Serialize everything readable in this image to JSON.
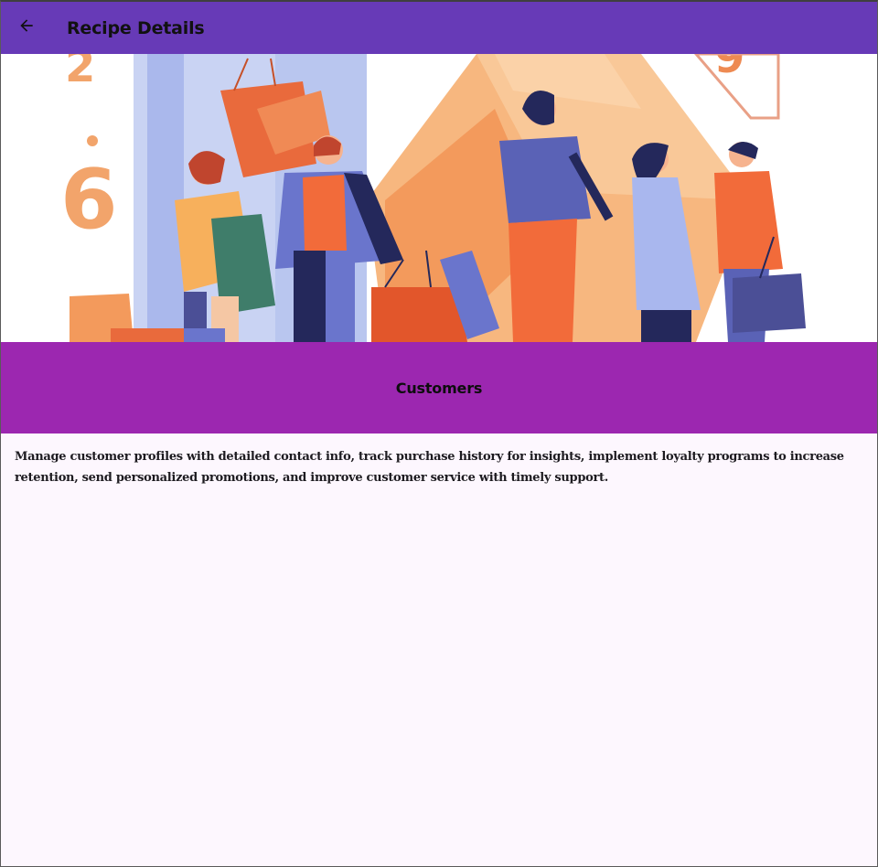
{
  "appbar": {
    "title": "Recipe Details",
    "back_icon": "arrow-back-icon",
    "background": "#673ab7"
  },
  "hero": {
    "alt": "shopping-illustration"
  },
  "banner": {
    "title": "Customers",
    "background": "#9c27b0"
  },
  "description": "Manage customer profiles with detailed contact info, track purchase history for insights, implement loyalty programs to increase retention, send personalized promotions, and improve customer service with timely support."
}
